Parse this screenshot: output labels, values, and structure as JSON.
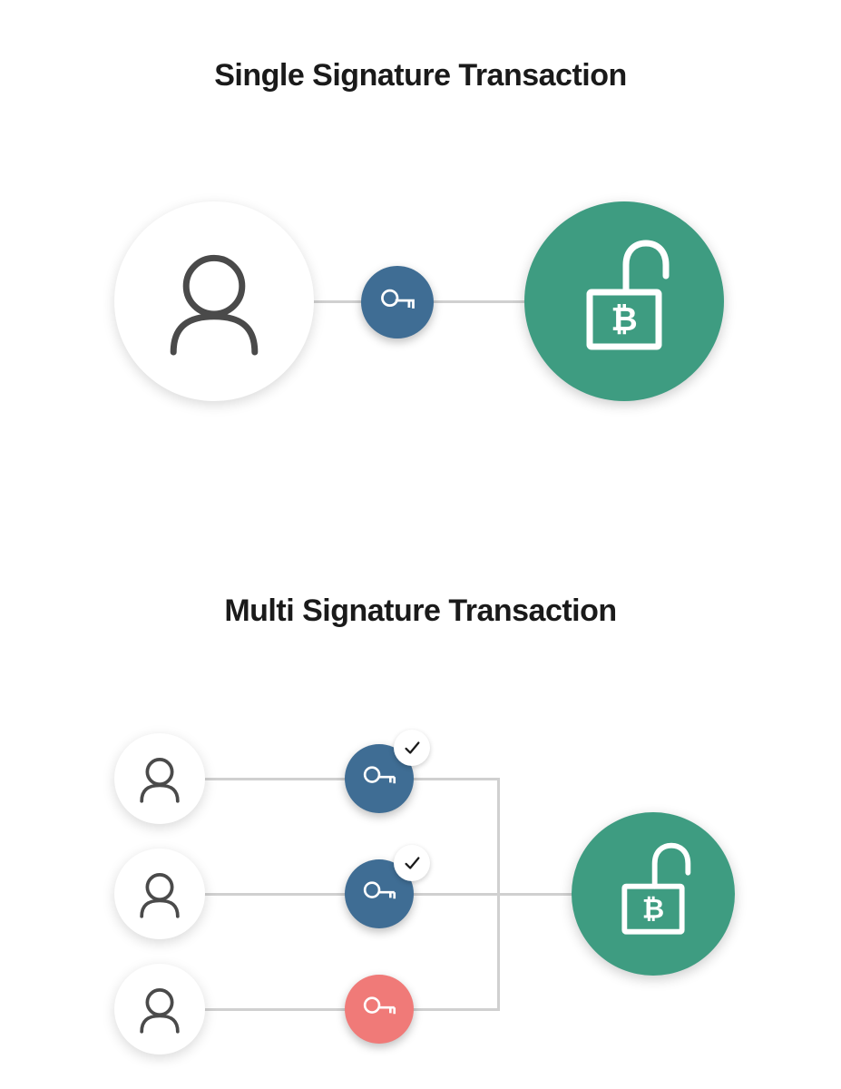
{
  "single": {
    "title": "Single Signature Transaction"
  },
  "multi": {
    "title": "Multi Signature Transaction"
  },
  "colors": {
    "blue": "#3f6d94",
    "red": "#f07a78",
    "green": "#3e9c81",
    "stroke": "#4a4a4a",
    "line": "#d0d0d0"
  },
  "icons": {
    "user": "user-icon",
    "key": "key-icon",
    "lock": "unlock-bitcoin-icon",
    "check": "check-icon"
  }
}
